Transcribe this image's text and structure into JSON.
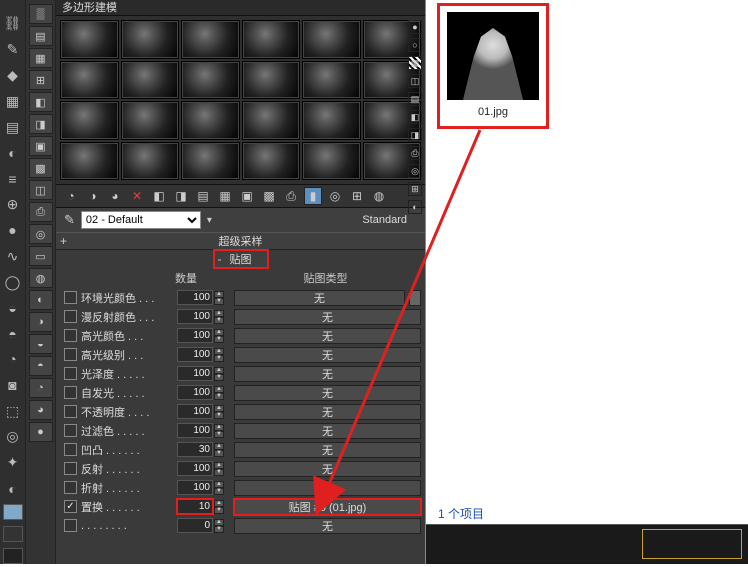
{
  "titlebar": "多边形建模",
  "material_name": "02 - Default",
  "material_type": "Standard",
  "rollouts": {
    "supersampling": "超级采样",
    "maps": "贴图"
  },
  "maps_columns": {
    "amount": "数量",
    "maptype": "贴图类型"
  },
  "map_slots": [
    {
      "checked": false,
      "label": "环境光颜色 . . .",
      "amount": "100",
      "map": "无"
    },
    {
      "checked": false,
      "label": "漫反射颜色 . . .",
      "amount": "100",
      "map": "无"
    },
    {
      "checked": false,
      "label": "高光颜色 . . .",
      "amount": "100",
      "map": "无"
    },
    {
      "checked": false,
      "label": "高光级别 . . .",
      "amount": "100",
      "map": "无"
    },
    {
      "checked": false,
      "label": "光泽度 . . . . .",
      "amount": "100",
      "map": "无"
    },
    {
      "checked": false,
      "label": "自发光 . . . . .",
      "amount": "100",
      "map": "无"
    },
    {
      "checked": false,
      "label": "不透明度 . . . .",
      "amount": "100",
      "map": "无"
    },
    {
      "checked": false,
      "label": "过滤色 . . . . .",
      "amount": "100",
      "map": "无"
    },
    {
      "checked": false,
      "label": "凹凸 . . . . . .",
      "amount": "30",
      "map": "无"
    },
    {
      "checked": false,
      "label": "反射 . . . . . .",
      "amount": "100",
      "map": "无"
    },
    {
      "checked": false,
      "label": "折射 . . . . . .",
      "amount": "100",
      "map": "无"
    },
    {
      "checked": true,
      "label": "置换 . . . . . .",
      "amount": "10",
      "map": "贴图 #0 (01.jpg)"
    },
    {
      "checked": false,
      "label": " . . . . . . . .",
      "amount": "0",
      "map": "无"
    }
  ],
  "file": {
    "name": "01.jpg",
    "count": "1 个项目"
  },
  "toolrow_icons": [
    "◔",
    "◑",
    "◕",
    "✕",
    "◧",
    "◨",
    "▤",
    "▦",
    "▣",
    "▩",
    "⎙",
    "▮",
    "◎",
    "⊞",
    "◍"
  ],
  "ltb_icons": [
    "⛓",
    "✎",
    "◆",
    "▦",
    "▤",
    "◐",
    "≡",
    "⊕",
    "●",
    "∿",
    "◯",
    "◒",
    "◓",
    "◔",
    "◙",
    "⬚",
    "◎",
    "✦",
    "◐"
  ],
  "ltb2_icons": [
    "▒",
    "▤",
    "▦",
    "⊞",
    "◧",
    "◨",
    "▣",
    "▩",
    "◫",
    "⎙",
    "◎",
    "▭",
    "◍",
    "◐",
    "◑",
    "◒",
    "◓",
    "◔",
    "◕",
    "●"
  ],
  "rpal_icons": [
    "●",
    "○",
    "▦",
    "◫",
    "▤",
    "◧",
    "◨",
    "⎙",
    "◎",
    "⊞",
    "◐"
  ]
}
